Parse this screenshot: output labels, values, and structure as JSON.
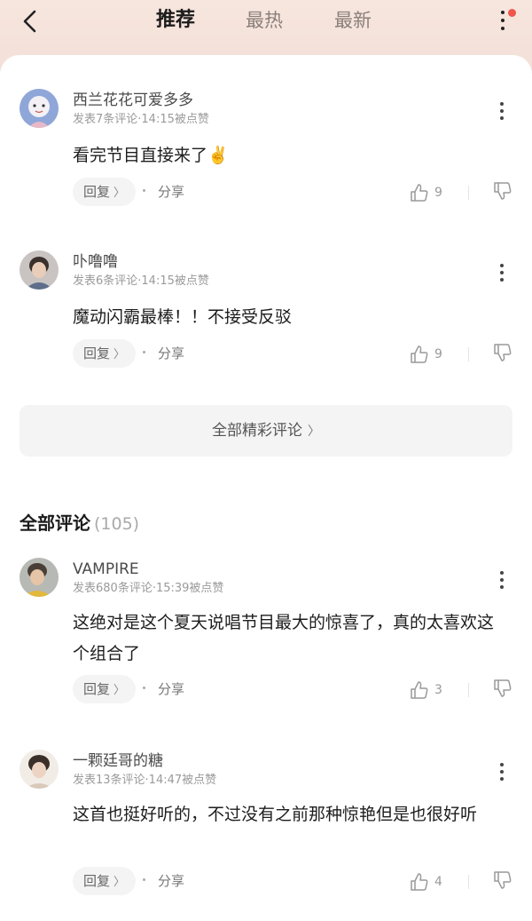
{
  "header": {
    "tabs": [
      {
        "label": "推荐",
        "active": true
      },
      {
        "label": "最热",
        "active": false
      },
      {
        "label": "最新",
        "active": false
      }
    ],
    "accent_color": "#f0554b"
  },
  "hot_comments": [
    {
      "username": "西兰花花可爱多多",
      "meta": "发表7条评论·14:15被点赞",
      "text": "看完节目直接来了✌️",
      "reply_label": "回复",
      "share_label": "分享",
      "likes": "9"
    },
    {
      "username": "卟噜噜",
      "meta": "发表6条评论·14:15被点赞",
      "text": "魔动闪霸最棒！！不接受反驳",
      "reply_label": "回复",
      "share_label": "分享",
      "likes": "9"
    }
  ],
  "all_hot_button": {
    "label": "全部精彩评论"
  },
  "all_comments": {
    "title": "全部评论",
    "count": "(105)",
    "items": [
      {
        "username": "VAMPIRE",
        "meta": "发表680条评论·15:39被点赞",
        "text": "这绝对是这个夏天说唱节目最大的惊喜了，真的太喜欢这个组合了",
        "reply_label": "回复",
        "share_label": "分享",
        "likes": "3"
      },
      {
        "username": "一颗廷哥的糖",
        "meta": "发表13条评论·14:47被点赞",
        "text": "这首也挺好听的，不过没有之前那种惊艳但是也很好听",
        "reply_label": "回复",
        "share_label": "分享",
        "likes": "4"
      }
    ]
  }
}
